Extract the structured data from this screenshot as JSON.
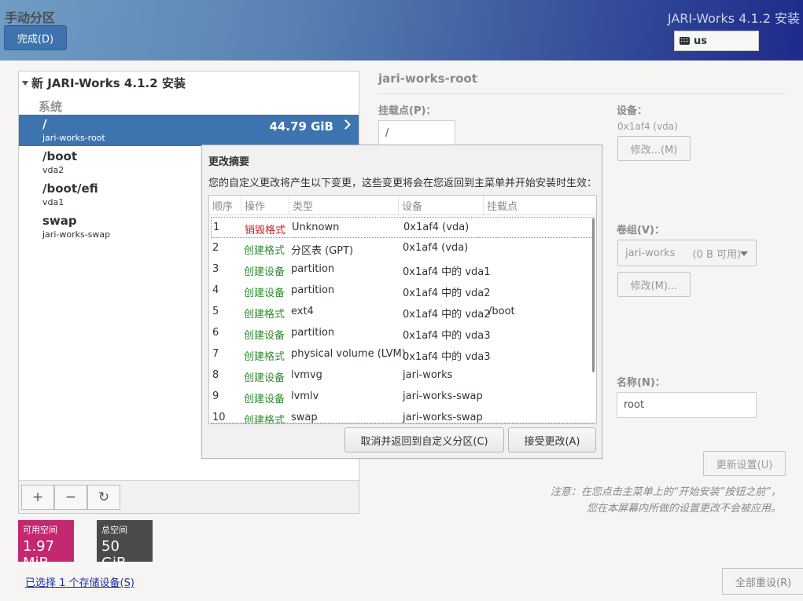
{
  "header": {
    "page_title": "手动分区",
    "done_button": "完成(D)",
    "product_title": "JARI-Works 4.1.2 安装",
    "keyboard_layout": "us"
  },
  "left_panel": {
    "root_label": "新 JARI-Works 4.1.2 安装",
    "group_label": "系统",
    "mount_points": [
      {
        "name": "/",
        "sub": "jari-works-root",
        "size": "44.79 GiB",
        "selected": true
      },
      {
        "name": "/boot",
        "sub": "vda2",
        "size": "",
        "selected": false
      },
      {
        "name": "/boot/efi",
        "sub": "vda1",
        "size": "",
        "selected": false
      },
      {
        "name": "swap",
        "sub": "jari-works-swap",
        "size": "",
        "selected": false
      }
    ],
    "tools": {
      "add": "+",
      "remove": "−",
      "refresh": "↻"
    }
  },
  "space": {
    "available_label": "可用空间",
    "available_value": "1.97 MiB",
    "available_color": "#c4286e",
    "total_label": "总空间",
    "total_value": "50 GiB",
    "total_color": "#4a4a4a"
  },
  "storage_link": "已选择 1 个存储设备(S)",
  "detail": {
    "title": "jari-works-root",
    "mount_point_label": "挂载点(P)：",
    "mount_point_value": "/",
    "device_label": "设备：",
    "device_value": "0x1af4 (vda)",
    "device_modify": "修改...(M)",
    "volume_group_label": "卷组(V)：",
    "volume_group_value": "jari-works",
    "volume_group_free": "(0 B 可用)",
    "volume_group_modify": "修改(M)...",
    "name_label": "名称(N)：",
    "name_value": "root",
    "update_button": "更新设置(U)",
    "note_line1": "注意：在您点击主菜单上的“开始安装”按钮之前”，",
    "note_line2": "您在本屏幕内所做的设置更改不会被应用。",
    "reset_all": "全部重设(R)"
  },
  "dialog": {
    "title": "更改摘要",
    "description": "您的自定义更改将产生以下变更，这些变更将会在您返回到主菜单并开始安装时生效：",
    "columns": [
      "顺序",
      "操作",
      "类型",
      "设备",
      "挂载点"
    ],
    "rows": [
      {
        "order": "1",
        "action": "销毁格式",
        "kind": "destroy",
        "type": "Unknown",
        "device": "0x1af4 (vda)",
        "mount": ""
      },
      {
        "order": "2",
        "action": "创建格式",
        "kind": "create",
        "type": "分区表 (GPT)",
        "device": "0x1af4 (vda)",
        "mount": ""
      },
      {
        "order": "3",
        "action": "创建设备",
        "kind": "create",
        "type": "partition",
        "device": "0x1af4 中的 vda1",
        "mount": ""
      },
      {
        "order": "4",
        "action": "创建设备",
        "kind": "create",
        "type": "partition",
        "device": "0x1af4 中的 vda2",
        "mount": ""
      },
      {
        "order": "5",
        "action": "创建格式",
        "kind": "create",
        "type": "ext4",
        "device": "0x1af4 中的 vda2",
        "mount": "/boot"
      },
      {
        "order": "6",
        "action": "创建设备",
        "kind": "create",
        "type": "partition",
        "device": "0x1af4 中的 vda3",
        "mount": ""
      },
      {
        "order": "7",
        "action": "创建格式",
        "kind": "create",
        "type": "physical volume (LVM)",
        "device": "0x1af4 中的 vda3",
        "mount": ""
      },
      {
        "order": "8",
        "action": "创建设备",
        "kind": "create",
        "type": "lvmvg",
        "device": "jari-works",
        "mount": ""
      },
      {
        "order": "9",
        "action": "创建设备",
        "kind": "create",
        "type": "lvmlv",
        "device": "jari-works-swap",
        "mount": ""
      },
      {
        "order": "10",
        "action": "创建格式",
        "kind": "create",
        "type": "swap",
        "device": "jari-works-swap",
        "mount": ""
      }
    ],
    "cancel_button": "取消并返回到自定义分区(C)",
    "accept_button": "接受更改(A)"
  }
}
